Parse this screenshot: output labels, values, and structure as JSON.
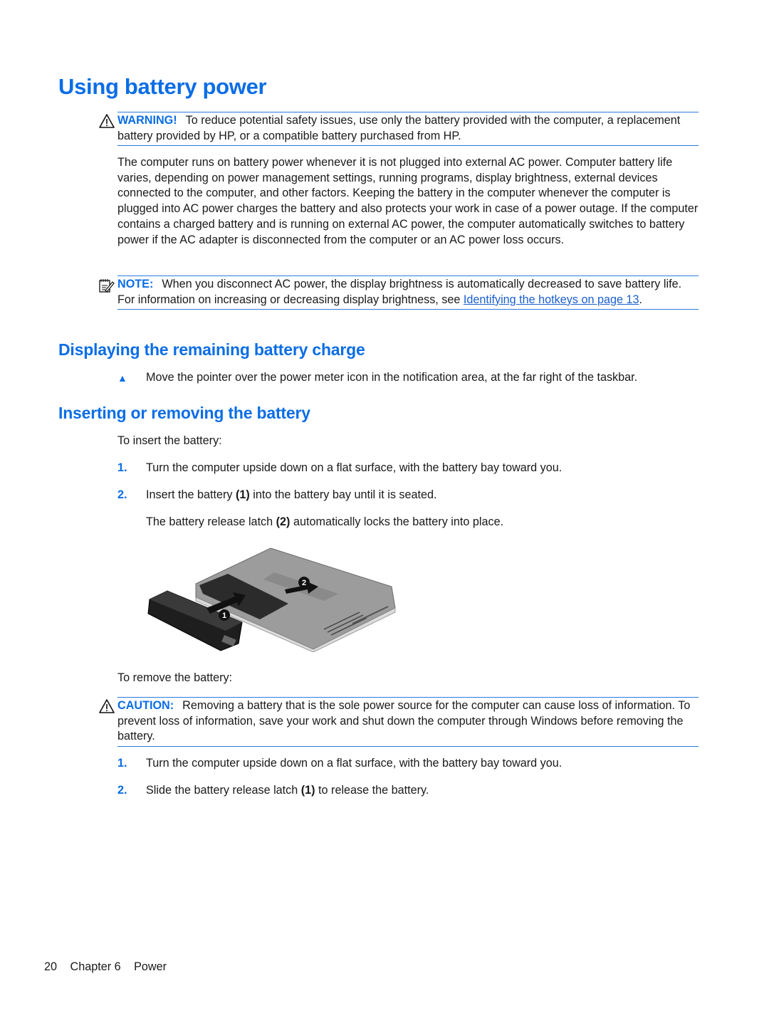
{
  "page": {
    "title": "Using battery power",
    "warning": {
      "label": "WARNING!",
      "icon": "warning-triangle-icon",
      "text": "To reduce potential safety issues, use only the battery provided with the computer, a replacement battery provided by HP, or a compatible battery purchased from HP."
    },
    "intro_paragraph": "The computer runs on battery power whenever it is not plugged into external AC power. Computer battery life varies, depending on power management settings, running programs, display brightness, external devices connected to the computer, and other factors. Keeping the battery in the computer whenever the computer is plugged into AC power charges the battery and also protects your work in case of a power outage. If the computer contains a charged battery and is running on external AC power, the computer automatically switches to battery power if the AC adapter is disconnected from the computer or an AC power loss occurs.",
    "note": {
      "label": "NOTE:",
      "icon": "note-pencil-icon",
      "text": "When you disconnect AC power, the display brightness is automatically decreased to save battery life. For information on increasing or decreasing display brightness, see ",
      "link_text": "Identifying the hotkeys on page 13",
      "after_link": "."
    },
    "sections": [
      {
        "heading": "Displaying the remaining battery charge",
        "bullet": "▲",
        "bullet_text": "Move the pointer over the power meter icon in the notification area, at the far right of the taskbar."
      },
      {
        "heading": "Inserting or removing the battery",
        "insert_intro": "To insert the battery:",
        "insert_steps": [
          {
            "num": "1.",
            "text": "Turn the computer upside down on a flat surface, with the battery bay toward you."
          },
          {
            "num": "2.",
            "pre": "Insert the battery ",
            "bold": "(1)",
            "post": " into the battery bay until it is seated."
          }
        ],
        "insert_sub": {
          "pre": "The battery release latch ",
          "bold": "(2)",
          "post": " automatically locks the battery into place."
        },
        "figure": {
          "callouts": [
            "1",
            "2"
          ],
          "alt": "Battery being inserted into laptop battery bay"
        },
        "remove_intro": "To remove the battery:",
        "caution": {
          "label": "CAUTION:",
          "icon": "caution-triangle-icon",
          "text": "Removing a battery that is the sole power source for the computer can cause loss of information. To prevent loss of information, save your work and shut down the computer through Windows before removing the battery."
        },
        "remove_steps": [
          {
            "num": "1.",
            "text": "Turn the computer upside down on a flat surface, with the battery bay toward you."
          },
          {
            "num": "2.",
            "pre": "Slide the battery release latch ",
            "bold": "(1)",
            "post": " to release the battery."
          }
        ]
      }
    ],
    "footer": {
      "page_number": "20",
      "chapter": "Chapter 6",
      "chapter_title": "Power"
    }
  }
}
